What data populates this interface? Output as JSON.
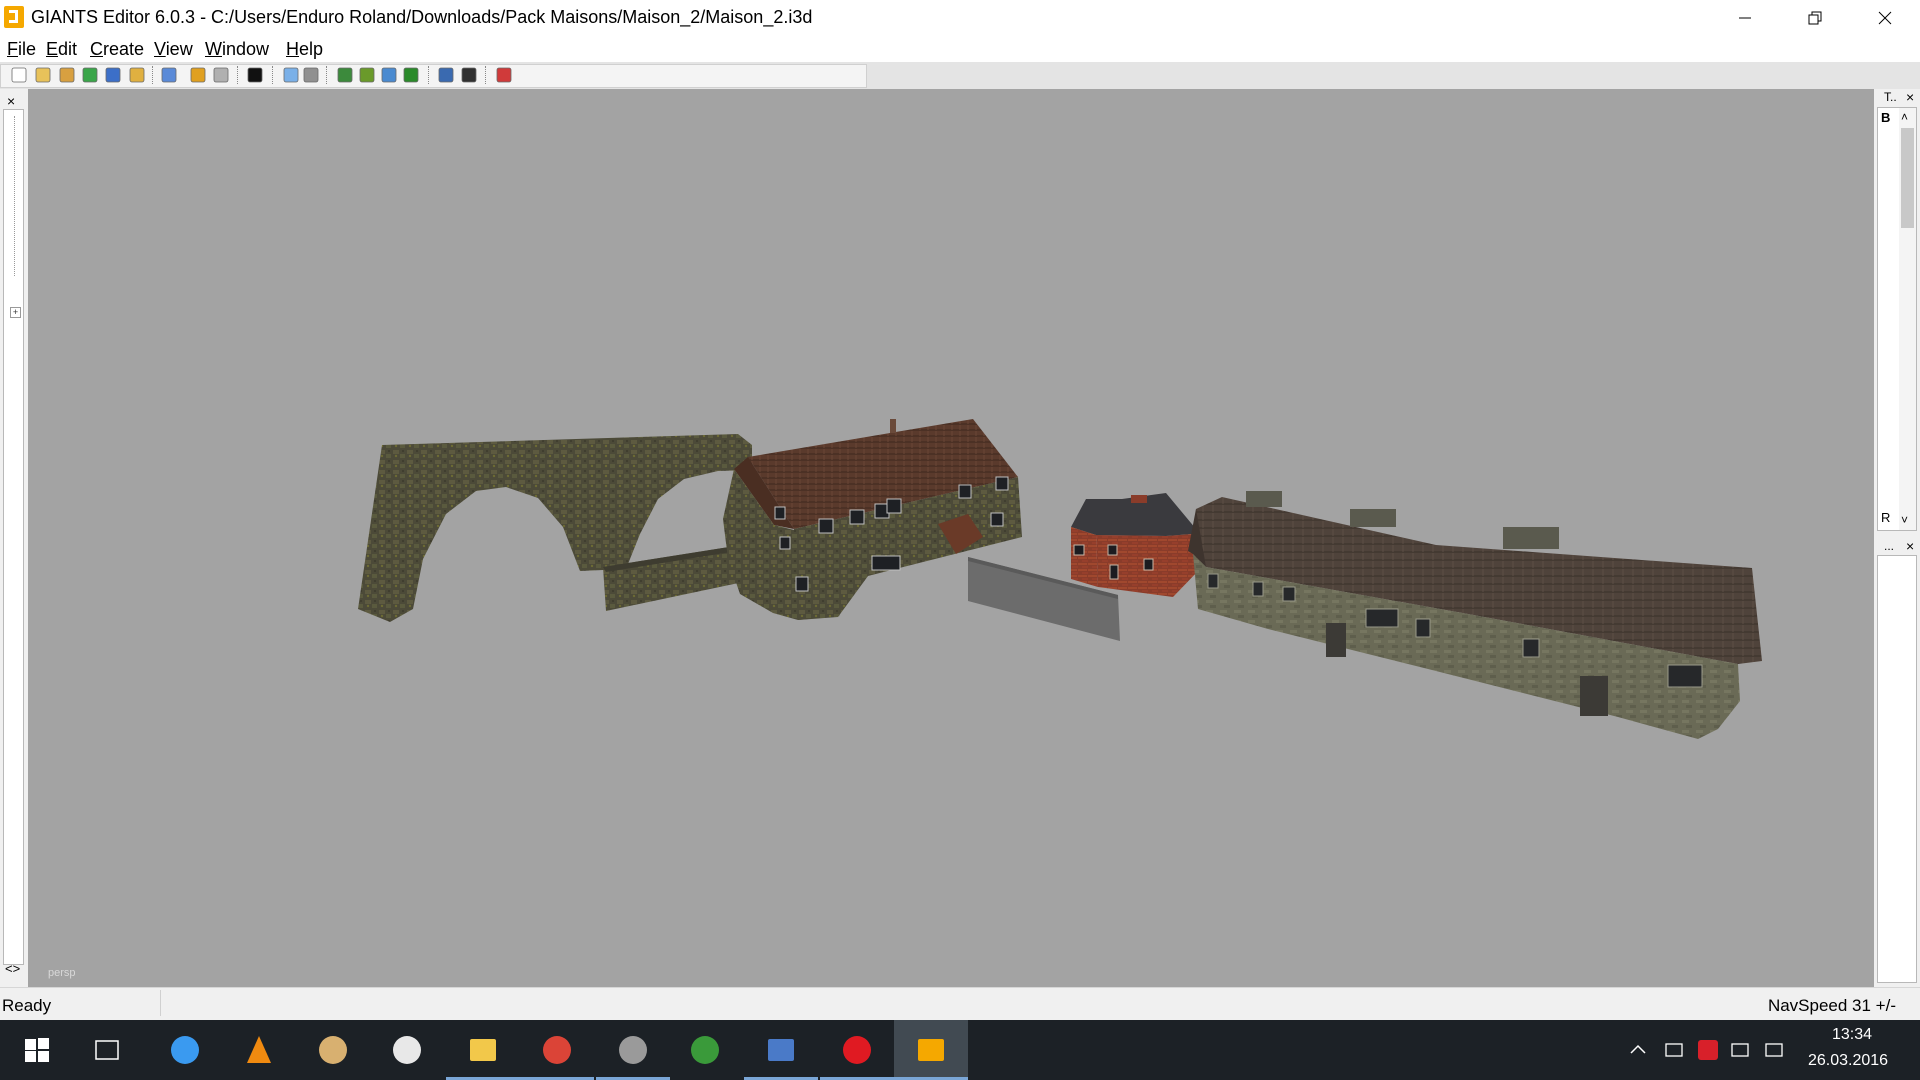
{
  "window": {
    "title": "GIANTS Editor 6.0.3 - C:/Users/Enduro Roland/Downloads/Pack Maisons/Maison_2/Maison_2.i3d",
    "app_icon": "giants-logo-icon",
    "controls": [
      "minimize-icon",
      "restore-icon",
      "close-icon"
    ]
  },
  "menubar": {
    "items": [
      {
        "acc": "F",
        "rest": "ile"
      },
      {
        "acc": "E",
        "rest": "dit"
      },
      {
        "acc": "C",
        "rest": "reate"
      },
      {
        "acc": "V",
        "rest": "iew"
      },
      {
        "acc": "W",
        "rest": "indow"
      },
      {
        "acc": "H",
        "rest": "elp"
      }
    ]
  },
  "toolbar": {
    "buttons": [
      {
        "icon": "new-file-icon",
        "color": "#ffffff"
      },
      {
        "icon": "open-folder-icon",
        "color": "#e8c25a"
      },
      {
        "icon": "edit-file-icon",
        "color": "#d8a040"
      },
      {
        "icon": "reload-icon",
        "color": "#3aa64a"
      },
      {
        "icon": "save-icon",
        "color": "#3c6fc8"
      },
      {
        "icon": "export-icon",
        "color": "#e0b040"
      },
      {
        "icon": "import-icon",
        "color": "#5a8ad8"
      },
      {
        "icon": "undo-icon",
        "color": "#e0a020"
      },
      {
        "icon": "redo-icon",
        "color": "#b0b0b0"
      },
      {
        "icon": "play-icon",
        "color": "#111111"
      },
      {
        "icon": "select-mode-icon",
        "color": "#7ab0e8"
      },
      {
        "icon": "magnet-icon",
        "color": "#909090"
      },
      {
        "icon": "terrain-paint-icon",
        "color": "#3c8a3c"
      },
      {
        "icon": "terrain-raise-icon",
        "color": "#6a9a2a"
      },
      {
        "icon": "terrain-lower-icon",
        "color": "#4a8ad0"
      },
      {
        "icon": "foliage-paint-icon",
        "color": "#2a8a2a"
      },
      {
        "icon": "rotate-gizmo-icon",
        "color": "#3a6ab0"
      },
      {
        "icon": "scale-gizmo-icon",
        "color": "#303030"
      },
      {
        "icon": "delete-icon",
        "color": "#d03a3a"
      }
    ]
  },
  "left_panel": {
    "close_label": "×",
    "nav_arrows": "<>"
  },
  "viewport": {
    "camera_label": "persp",
    "background": "#a3a3a3"
  },
  "right_panel": {
    "top_title": "T..",
    "top_close": "×",
    "top_text_1": "B",
    "top_text_2": "R",
    "bottom_title": "...",
    "bottom_close": "×"
  },
  "statusbar": {
    "status": "Ready",
    "nav_speed": "NavSpeed 31 +/-"
  },
  "taskbar": {
    "apps": [
      {
        "icon": "windows-start-icon",
        "color": "#ffffff"
      },
      {
        "icon": "task-view-icon",
        "color": "#ffffff"
      },
      {
        "icon": "thunderbolt-app-icon",
        "color": "#3a9af0"
      },
      {
        "icon": "vlc-icon",
        "color": "#f08a10"
      },
      {
        "icon": "paint-palette-icon",
        "color": "#d8b070"
      },
      {
        "icon": "obs-icon",
        "color": "#e8e8e8"
      },
      {
        "icon": "file-explorer-icon",
        "color": "#f2c84a"
      },
      {
        "icon": "chrome-icon",
        "color": "#db4437"
      },
      {
        "icon": "video-editor-icon",
        "color": "#9a9a9a"
      },
      {
        "icon": "scissors-app-icon",
        "color": "#3a9a3a"
      },
      {
        "icon": "remote-desktop-icon",
        "color": "#4a7ac8"
      },
      {
        "icon": "opera-icon",
        "color": "#e01a22"
      },
      {
        "icon": "giants-editor-taskbar-icon",
        "color": "#f5a800"
      }
    ],
    "active_app": "giants-editor-taskbar-icon",
    "tray": [
      "chevron-up-icon",
      "volume-icon",
      "antivirus-icon",
      "network-icon",
      "action-center-icon"
    ],
    "time": "13:34",
    "date": "26.03.2016"
  }
}
